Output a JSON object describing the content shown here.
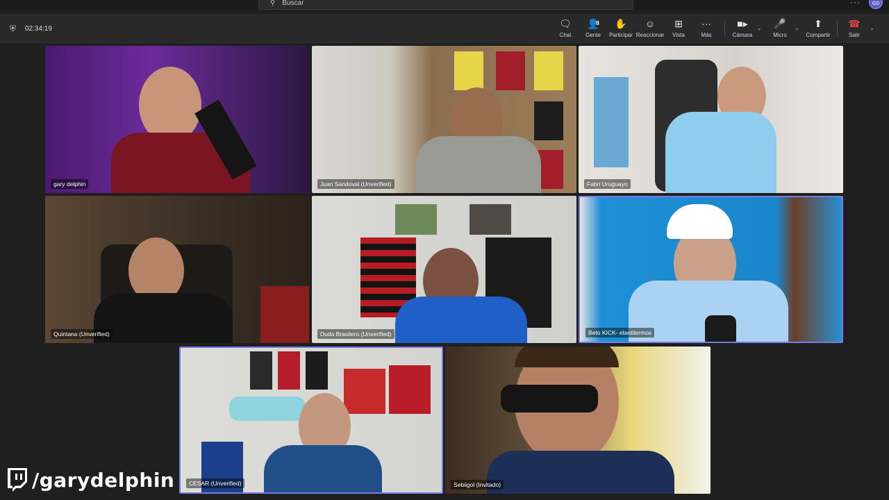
{
  "search": {
    "placeholder": "Buscar"
  },
  "account": {
    "initials": "GD"
  },
  "meeting": {
    "timer": "02:34:19"
  },
  "toolbar": [
    {
      "id": "chat",
      "label": "Chat",
      "icon": "chat-icon"
    },
    {
      "id": "people",
      "label": "Gente",
      "icon": "people-icon",
      "count": "8"
    },
    {
      "id": "raise",
      "label": "Participar",
      "icon": "raise-hand-icon"
    },
    {
      "id": "react",
      "label": "Reaccionar",
      "icon": "smiley-icon"
    },
    {
      "id": "view",
      "label": "Vista",
      "icon": "grid-icon"
    },
    {
      "id": "more",
      "label": "Más",
      "icon": "more-icon"
    },
    {
      "id": "camera",
      "label": "Cámara",
      "icon": "camera-icon"
    },
    {
      "id": "mic",
      "label": "Micro",
      "icon": "microphone-icon"
    },
    {
      "id": "share",
      "label": "Compartir",
      "icon": "share-icon"
    },
    {
      "id": "leave",
      "label": "Salir",
      "icon": "hangup-icon"
    }
  ],
  "participants": [
    {
      "name": "gary delphin",
      "speaking": false
    },
    {
      "name": "Juan Sandoval (Unverified)",
      "speaking": false
    },
    {
      "name": "Fabri Uruguayo",
      "speaking": false
    },
    {
      "name": "Quintana (Unverified)",
      "speaking": false
    },
    {
      "name": "Duda Brasilero (Unverified)",
      "speaking": false
    },
    {
      "name": "Beto KICK- elantitermos",
      "speaking": true
    },
    {
      "name": "CESAR (Unverified)",
      "speaking": true
    },
    {
      "name": "Sebiigol (Invitado)",
      "speaking": false
    }
  ],
  "overlay": {
    "twitch_handle": "/garydelphin"
  },
  "colors": {
    "background": "#1f1f1f",
    "toolbar": "#292929",
    "speaking_border": "#7a7ae6",
    "leave": "#e0404a"
  }
}
